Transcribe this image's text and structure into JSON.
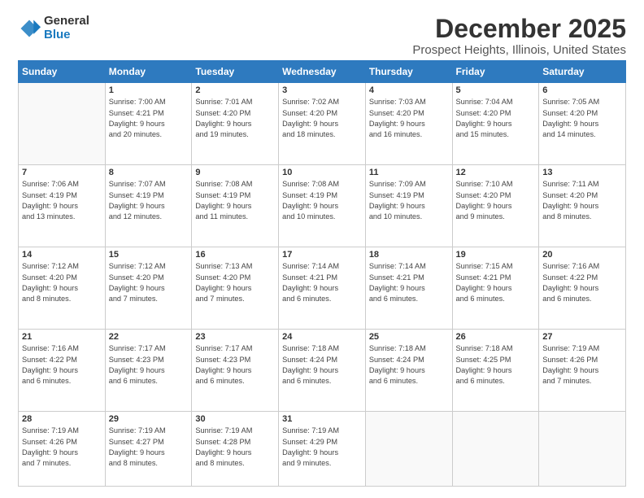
{
  "logo": {
    "general": "General",
    "blue": "Blue"
  },
  "title": "December 2025",
  "subtitle": "Prospect Heights, Illinois, United States",
  "headers": [
    "Sunday",
    "Monday",
    "Tuesday",
    "Wednesday",
    "Thursday",
    "Friday",
    "Saturday"
  ],
  "weeks": [
    [
      {
        "day": "",
        "info": ""
      },
      {
        "day": "1",
        "info": "Sunrise: 7:00 AM\nSunset: 4:21 PM\nDaylight: 9 hours\nand 20 minutes."
      },
      {
        "day": "2",
        "info": "Sunrise: 7:01 AM\nSunset: 4:20 PM\nDaylight: 9 hours\nand 19 minutes."
      },
      {
        "day": "3",
        "info": "Sunrise: 7:02 AM\nSunset: 4:20 PM\nDaylight: 9 hours\nand 18 minutes."
      },
      {
        "day": "4",
        "info": "Sunrise: 7:03 AM\nSunset: 4:20 PM\nDaylight: 9 hours\nand 16 minutes."
      },
      {
        "day": "5",
        "info": "Sunrise: 7:04 AM\nSunset: 4:20 PM\nDaylight: 9 hours\nand 15 minutes."
      },
      {
        "day": "6",
        "info": "Sunrise: 7:05 AM\nSunset: 4:20 PM\nDaylight: 9 hours\nand 14 minutes."
      }
    ],
    [
      {
        "day": "7",
        "info": "Sunrise: 7:06 AM\nSunset: 4:19 PM\nDaylight: 9 hours\nand 13 minutes."
      },
      {
        "day": "8",
        "info": "Sunrise: 7:07 AM\nSunset: 4:19 PM\nDaylight: 9 hours\nand 12 minutes."
      },
      {
        "day": "9",
        "info": "Sunrise: 7:08 AM\nSunset: 4:19 PM\nDaylight: 9 hours\nand 11 minutes."
      },
      {
        "day": "10",
        "info": "Sunrise: 7:08 AM\nSunset: 4:19 PM\nDaylight: 9 hours\nand 10 minutes."
      },
      {
        "day": "11",
        "info": "Sunrise: 7:09 AM\nSunset: 4:19 PM\nDaylight: 9 hours\nand 10 minutes."
      },
      {
        "day": "12",
        "info": "Sunrise: 7:10 AM\nSunset: 4:20 PM\nDaylight: 9 hours\nand 9 minutes."
      },
      {
        "day": "13",
        "info": "Sunrise: 7:11 AM\nSunset: 4:20 PM\nDaylight: 9 hours\nand 8 minutes."
      }
    ],
    [
      {
        "day": "14",
        "info": "Sunrise: 7:12 AM\nSunset: 4:20 PM\nDaylight: 9 hours\nand 8 minutes."
      },
      {
        "day": "15",
        "info": "Sunrise: 7:12 AM\nSunset: 4:20 PM\nDaylight: 9 hours\nand 7 minutes."
      },
      {
        "day": "16",
        "info": "Sunrise: 7:13 AM\nSunset: 4:20 PM\nDaylight: 9 hours\nand 7 minutes."
      },
      {
        "day": "17",
        "info": "Sunrise: 7:14 AM\nSunset: 4:21 PM\nDaylight: 9 hours\nand 6 minutes."
      },
      {
        "day": "18",
        "info": "Sunrise: 7:14 AM\nSunset: 4:21 PM\nDaylight: 9 hours\nand 6 minutes."
      },
      {
        "day": "19",
        "info": "Sunrise: 7:15 AM\nSunset: 4:21 PM\nDaylight: 9 hours\nand 6 minutes."
      },
      {
        "day": "20",
        "info": "Sunrise: 7:16 AM\nSunset: 4:22 PM\nDaylight: 9 hours\nand 6 minutes."
      }
    ],
    [
      {
        "day": "21",
        "info": "Sunrise: 7:16 AM\nSunset: 4:22 PM\nDaylight: 9 hours\nand 6 minutes."
      },
      {
        "day": "22",
        "info": "Sunrise: 7:17 AM\nSunset: 4:23 PM\nDaylight: 9 hours\nand 6 minutes."
      },
      {
        "day": "23",
        "info": "Sunrise: 7:17 AM\nSunset: 4:23 PM\nDaylight: 9 hours\nand 6 minutes."
      },
      {
        "day": "24",
        "info": "Sunrise: 7:18 AM\nSunset: 4:24 PM\nDaylight: 9 hours\nand 6 minutes."
      },
      {
        "day": "25",
        "info": "Sunrise: 7:18 AM\nSunset: 4:24 PM\nDaylight: 9 hours\nand 6 minutes."
      },
      {
        "day": "26",
        "info": "Sunrise: 7:18 AM\nSunset: 4:25 PM\nDaylight: 9 hours\nand 6 minutes."
      },
      {
        "day": "27",
        "info": "Sunrise: 7:19 AM\nSunset: 4:26 PM\nDaylight: 9 hours\nand 7 minutes."
      }
    ],
    [
      {
        "day": "28",
        "info": "Sunrise: 7:19 AM\nSunset: 4:26 PM\nDaylight: 9 hours\nand 7 minutes."
      },
      {
        "day": "29",
        "info": "Sunrise: 7:19 AM\nSunset: 4:27 PM\nDaylight: 9 hours\nand 8 minutes."
      },
      {
        "day": "30",
        "info": "Sunrise: 7:19 AM\nSunset: 4:28 PM\nDaylight: 9 hours\nand 8 minutes."
      },
      {
        "day": "31",
        "info": "Sunrise: 7:19 AM\nSunset: 4:29 PM\nDaylight: 9 hours\nand 9 minutes."
      },
      {
        "day": "",
        "info": ""
      },
      {
        "day": "",
        "info": ""
      },
      {
        "day": "",
        "info": ""
      }
    ]
  ]
}
